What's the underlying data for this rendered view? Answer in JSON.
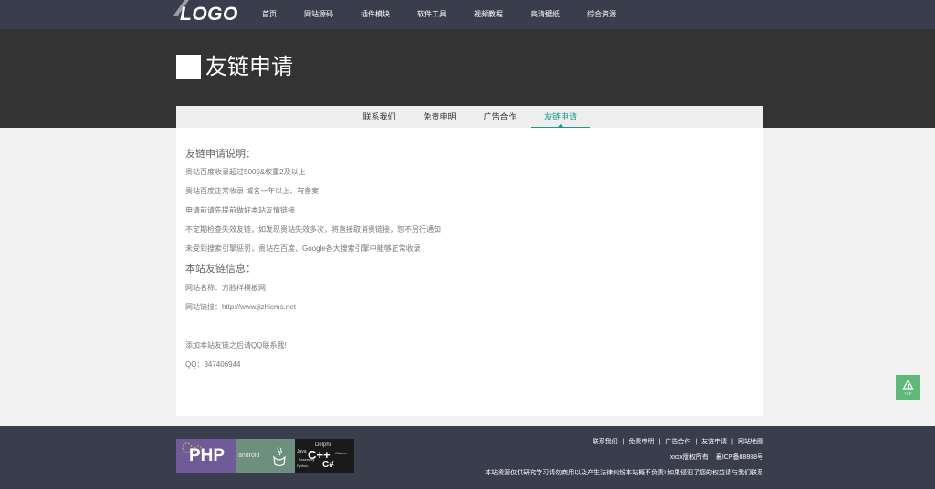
{
  "header": {
    "logo": "LOGO",
    "nav": [
      "首页",
      "网站源码",
      "插件模块",
      "软件工具",
      "视频教程",
      "高清壁纸",
      "综合资源"
    ]
  },
  "banner": {
    "title": "友链申请"
  },
  "subnav": {
    "tabs": [
      "联系我们",
      "免责申明",
      "广告合作",
      "友链申请"
    ],
    "active": "友链申请"
  },
  "content": {
    "section1_title": "友链申请说明：",
    "rules": [
      "贵站百度收录超过5000&权重2及以上",
      "贵站百度正常收录 域名一年以上、有备案",
      "申请前请先提前做好本站友情链接",
      "不定期检查失效友链，如发现贵站失效多次，将直接取消贵链接，恕不另行通知",
      "未受到搜索引擎惩罚，贵站在百度、Google各大搜索引擎中能够正常收录"
    ],
    "section2_title": "本站友链信息：",
    "site_name": "网站名称：方脸样模板网",
    "site_url": "网站链接：http://www.jizhicms.net",
    "contact_note": "添加本站友链之后请QQ联系我!",
    "qq": "QQ：347406944"
  },
  "totop": {
    "label": "TOP"
  },
  "footer": {
    "badges": {
      "php": "PHP",
      "android": "android",
      "cloud": [
        "Delphi",
        "C++",
        "C#",
        "Java",
        "Python",
        "Assembly",
        "Clarion"
      ]
    },
    "links": [
      "联系我们",
      "免责申明",
      "广告合作",
      "友链申请",
      "网站地图"
    ],
    "separator": "|",
    "copyright": "xxxx版权所有",
    "icp": "襄ICP备88888号",
    "disclaimer": "本站资源仅供研究学习请勿商用以及产生法律纠纷本站概不负责! 如果侵犯了您的权益请与我们联系"
  },
  "colors": {
    "accent": "#1a9a86",
    "topbar": "#3a3d4c",
    "banner": "#333333",
    "totop": "#5fb878"
  }
}
